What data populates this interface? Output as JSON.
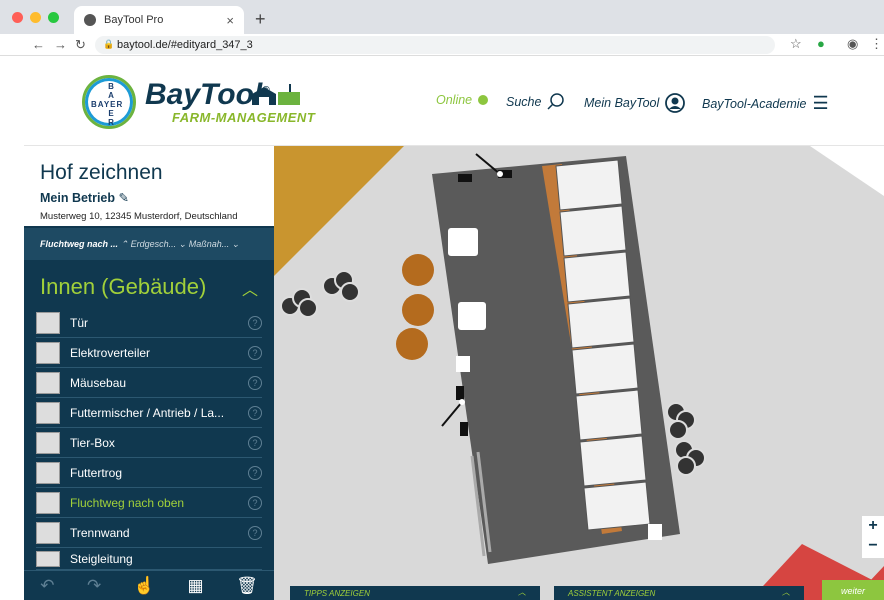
{
  "browser": {
    "tab_title": "BayTool Pro",
    "url": "baytool.de/#edityard_347_3"
  },
  "header": {
    "brand": "BayTool",
    "brand_sub": "FARM-MANAGEMENT",
    "bayer_logo": "BAYER",
    "online_label": "Online",
    "search_label": "Suche",
    "account_label": "Mein BayTool",
    "academy_label": "BayTool-Academie"
  },
  "sidebar": {
    "title": "Hof zeichnen",
    "farm_name": "Mein Betrieb",
    "address": "Musterweg 10, 12345 Musterdorf, Deutschland",
    "crumbs": [
      "Fluchtweg nach ...",
      "Erdgesch...",
      "Maßnah..."
    ],
    "section_title": "Innen (Gebäude)",
    "items": [
      {
        "label": "Tür",
        "active": false
      },
      {
        "label": "Elektroverteiler",
        "active": false
      },
      {
        "label": "Mäusebau",
        "active": false
      },
      {
        "label": "Futtermischer / Antrieb / La...",
        "active": false
      },
      {
        "label": "Tier-Box",
        "active": false
      },
      {
        "label": "Futtertrog",
        "active": false
      },
      {
        "label": "Fluchtweg nach oben",
        "active": true
      },
      {
        "label": "Trennwand",
        "active": false
      },
      {
        "label": "Steigleitung",
        "active": false
      }
    ],
    "help_glyph": "?"
  },
  "bottom": {
    "tips": "TIPPS ANZEIGEN",
    "assistant": "ASSISTENT ANZEIGEN",
    "next": "weiter"
  },
  "zoom": {
    "plus": "+",
    "minus": "−"
  },
  "colors": {
    "navy": "#10384f",
    "lime": "#a1d03a",
    "canvas_bg": "#d9d9d9",
    "field_orange": "#c9952f",
    "field_red": "#d64541",
    "building": "#5a5a5a"
  }
}
